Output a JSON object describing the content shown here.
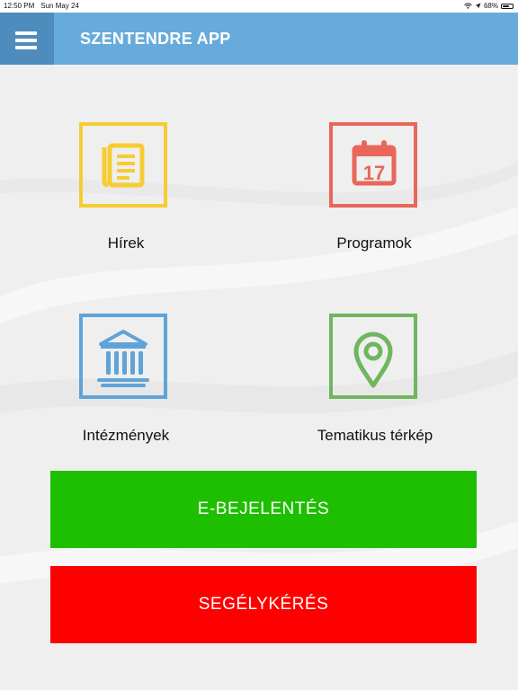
{
  "status_bar": {
    "time": "12:50 PM",
    "date": "Sun May 24",
    "battery": "68%",
    "battery_level": 0.68
  },
  "header": {
    "title": "SZENTENDRE APP",
    "menu_icon": "hamburger-menu-icon",
    "color": "#66abdb",
    "menu_color": "#4d8cbd"
  },
  "tiles": [
    {
      "label": "Hírek",
      "icon": "newspaper-icon",
      "color": "#f7cc31"
    },
    {
      "label": "Programok",
      "icon": "calendar-icon",
      "color": "#e8675a",
      "icon_text": "17"
    },
    {
      "label": "Intézmények",
      "icon": "institution-icon",
      "color": "#5fa3d8"
    },
    {
      "label": "Tematikus térkép",
      "icon": "map-pin-icon",
      "color": "#6fb65f"
    }
  ],
  "buttons": {
    "report": {
      "label": "E-BEJELENTÉS",
      "color": "#1ebe00"
    },
    "help": {
      "label": "SEGÉLYKÉRÉS",
      "color": "#ff0000"
    }
  }
}
